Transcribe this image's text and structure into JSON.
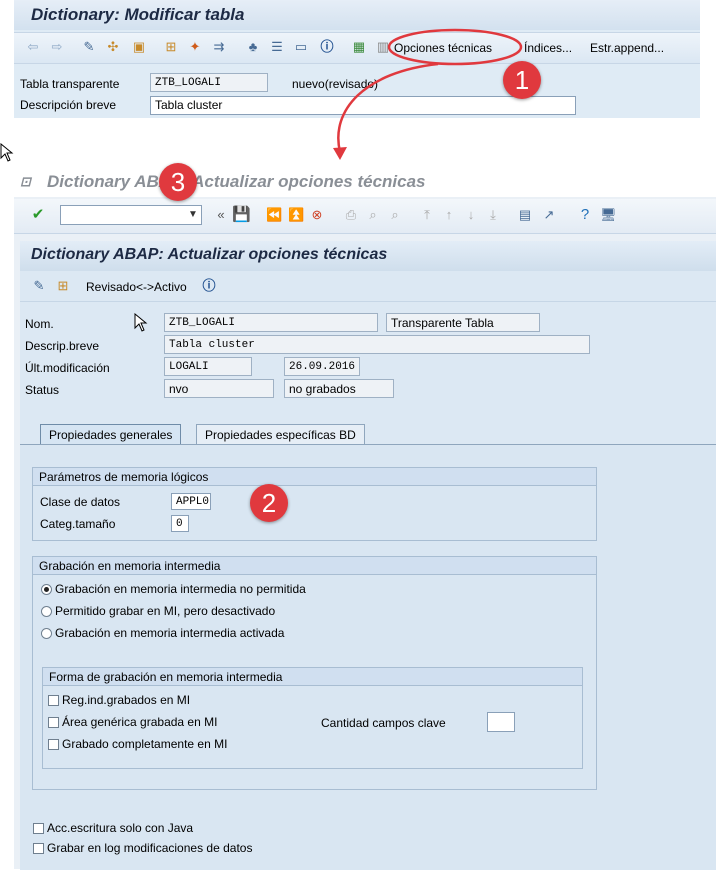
{
  "top_window": {
    "title": "Dictionary: Modificar tabla",
    "toolbar": {
      "opciones_tecnicas": "Opciones técnicas",
      "indices": "Índices...",
      "estr_append": "Estr.append..."
    },
    "fields": {
      "tabla_transparente_label": "Tabla transparente",
      "tabla_transparente_value": "ZTB_LOGALI",
      "tabla_status": "nuevo(revisado)",
      "descripcion_breve_label": "Descripción breve",
      "descripcion_breve_value": "Tabla cluster"
    }
  },
  "bottom_window": {
    "title": "Dictionary ABAP: Actualizar opciones técnicas",
    "panel_title": "Dictionary ABAP: Actualizar opciones técnicas",
    "revisado_activo": "Revisado<->Activo",
    "info": {
      "nom_label": "Nom.",
      "nom_value": "ZTB_LOGALI",
      "nom_type": "Transparente Tabla",
      "descrip_label": "Descrip.breve",
      "descrip_value": "Tabla cluster",
      "ult_mod_label": "Últ.modificación",
      "ult_mod_user": "LOGALI",
      "ult_mod_date": "26.09.2016",
      "status_label": "Status",
      "status_value": "nvo",
      "status_saved": "no grabados"
    },
    "tabs": {
      "general": "Propiedades generales",
      "bd": "Propiedades específicas BD"
    },
    "memoria_logicos": {
      "title": "Parámetros de memoria lógicos",
      "clase_label": "Clase de datos",
      "clase_value": "APPL0",
      "categ_label": "Categ.tamaño",
      "categ_value": "0"
    },
    "grabacion": {
      "title": "Grabación en memoria intermedia",
      "opt1": "Grabación en memoria intermedia no permitida",
      "opt2": "Permitido grabar en MI, pero desactivado",
      "opt3": "Grabación en memoria intermedia activada"
    },
    "forma": {
      "title": "Forma de grabación en memoria intermedia",
      "chk1": "Reg.ind.grabados en MI",
      "chk2": "Área genérica grabada en MI",
      "chk3": "Grabado completamente en MI",
      "cantidad_label": "Cantidad campos clave"
    },
    "bottom_checks": {
      "chk1": "Grabar en log modificaciones de datos",
      "chk2": "Acc.escritura solo con Java"
    }
  },
  "markers": {
    "m1": "1",
    "m2": "2",
    "m3": "3"
  },
  "colors": {
    "annotation_red": "#e0393e",
    "title_blue": "#1d2a44"
  }
}
